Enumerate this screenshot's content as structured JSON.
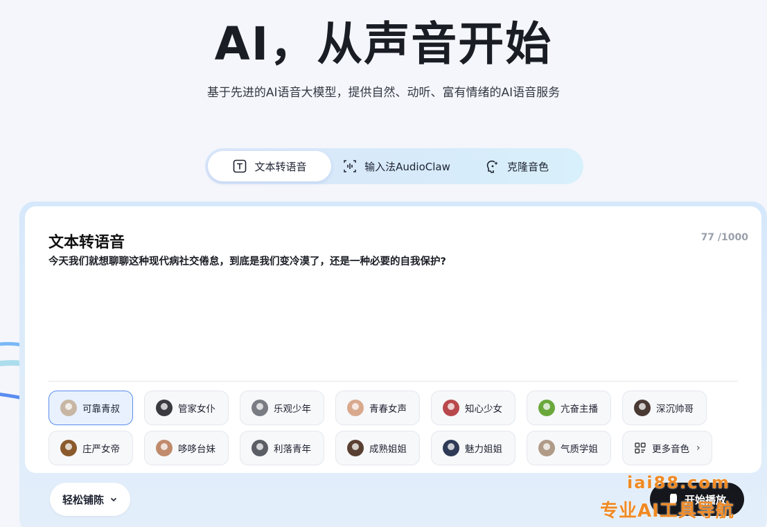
{
  "hero": {
    "title": "AI，从声音开始",
    "subtitle": "基于先进的AI语音大模型，提供自然、动听、富有情绪的AI语音服务"
  },
  "tabs": [
    {
      "label": "文本转语音",
      "icon": "text-t-icon",
      "active": true
    },
    {
      "label": "输入法AudioClaw",
      "icon": "audio-wave-icon",
      "active": false
    },
    {
      "label": "克隆音色",
      "icon": "voice-clone-icon",
      "active": false
    }
  ],
  "editor": {
    "title": "文本转语音",
    "counter": "77 /1000",
    "text": "今天我们就想聊聊这种现代病社交倦怠，到底是我们变冷漠了，还是一种必要的自我保护?"
  },
  "voices": [
    {
      "label": "可靠青叔",
      "color": "#c8b6a4",
      "active": true
    },
    {
      "label": "管家女仆",
      "color": "#3a3a40"
    },
    {
      "label": "乐观少年",
      "color": "#7a7c84"
    },
    {
      "label": "青春女声",
      "color": "#d9a98e"
    },
    {
      "label": "知心少女",
      "color": "#b8484c"
    },
    {
      "label": "亢奋主播",
      "color": "#6aa83c"
    },
    {
      "label": "深沉帅哥",
      "color": "#4a3a34"
    },
    {
      "label": "庄严女帝",
      "color": "#8a5a2c"
    },
    {
      "label": "哆哆台妹",
      "color": "#c08a6c"
    },
    {
      "label": "利落青年",
      "color": "#5c5e66"
    },
    {
      "label": "成熟姐姐",
      "color": "#5a4032"
    },
    {
      "label": "魅力姐姐",
      "color": "#2e3a56"
    },
    {
      "label": "气质学姐",
      "color": "#b09a88"
    },
    {
      "label": "更多音色",
      "icon": "grid-icon"
    }
  ],
  "controls": {
    "mode_label": "轻松铺陈",
    "play_label": "开始播放"
  },
  "watermark": {
    "domain": "iai88.com",
    "tagline": "专业AI工具导航"
  },
  "colors": {
    "accent": "#5b8def",
    "watermark": "#f08a24",
    "play_bg": "#15171c"
  }
}
